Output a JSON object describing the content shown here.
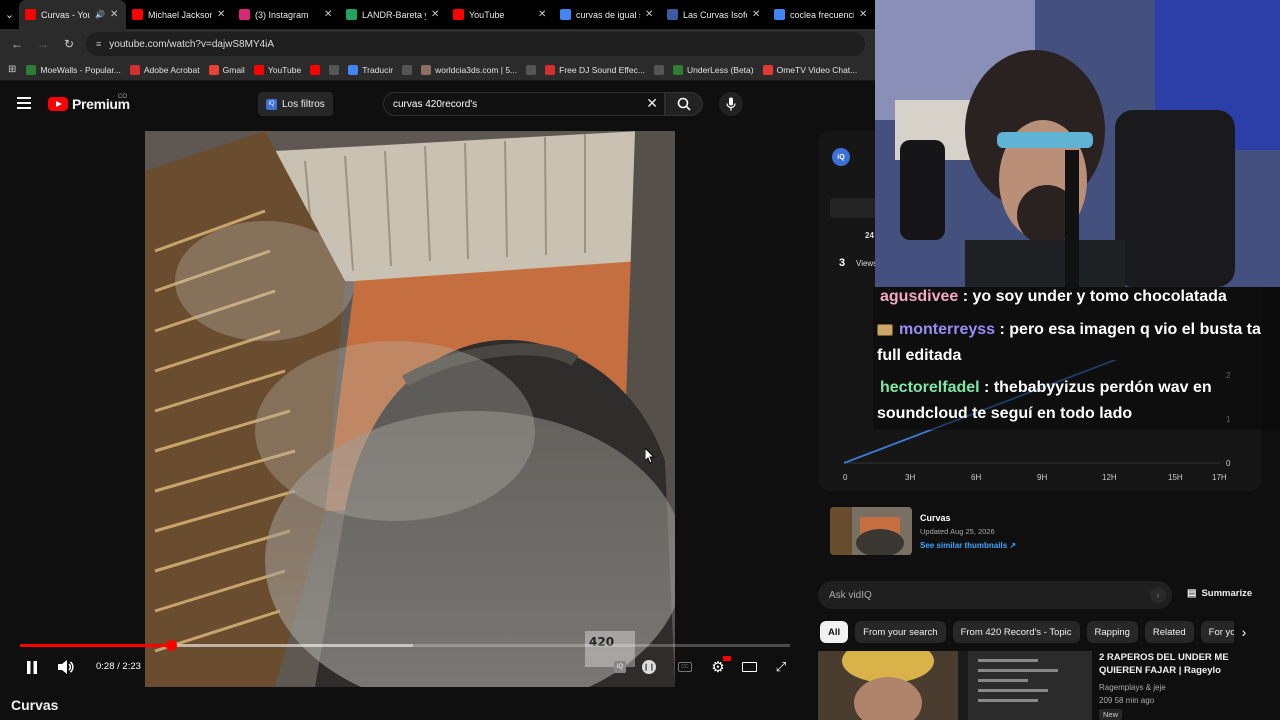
{
  "browser": {
    "tabs": [
      {
        "title": "Curvas - YouTu",
        "icon": "youtube-icon",
        "color": "#ff0000",
        "active": true,
        "audio": true
      },
      {
        "title": "Michael Jackson",
        "icon": "youtube-icon",
        "color": "#ff0000"
      },
      {
        "title": "(3) Instagram",
        "icon": "instagram-icon",
        "color": "#d62976"
      },
      {
        "title": "LANDR-Bareta y",
        "icon": "drive-icon",
        "color": "#1fa463"
      },
      {
        "title": "YouTube",
        "icon": "youtube-icon",
        "color": "#ff0000"
      },
      {
        "title": "curvas de igual s",
        "icon": "google-icon",
        "color": "#4285f4"
      },
      {
        "title": "Las Curvas Isofón",
        "icon": "site-icon",
        "color": "#3b5ba5"
      },
      {
        "title": "coclea frecuencia",
        "icon": "google-icon",
        "color": "#4285f4"
      }
    ],
    "url": "youtube.com/watch?v=dajwS8MY4iA",
    "bookmarks": [
      {
        "label": "MoeWalls - Popular...",
        "icon": "moewalls-icon",
        "color": "#2e7d32"
      },
      {
        "label": "Adobe Acrobat",
        "icon": "acrobat-icon",
        "color": "#d32f2f"
      },
      {
        "label": "Gmail",
        "icon": "gmail-icon",
        "color": "#ea4335"
      },
      {
        "label": "YouTube",
        "icon": "youtube-icon",
        "color": "#ff0000"
      },
      {
        "label": "",
        "icon": "youtube-icon",
        "color": "#ff0000"
      },
      {
        "label": "",
        "icon": "globe-icon",
        "color": "#555555"
      },
      {
        "label": "Traducir",
        "icon": "translate-icon",
        "color": "#4285f4"
      },
      {
        "label": "",
        "icon": "globe-icon",
        "color": "#555555"
      },
      {
        "label": "worldcia3ds.com | 5...",
        "icon": "worldcia-icon",
        "color": "#8d6e63"
      },
      {
        "label": "",
        "icon": "globe-icon",
        "color": "#555555"
      },
      {
        "label": "Free DJ Sound Effec...",
        "icon": "dj-icon",
        "color": "#d32f2f"
      },
      {
        "label": "",
        "icon": "globe-icon",
        "color": "#555555"
      },
      {
        "label": "UnderLess (Beta)",
        "icon": "underless-icon",
        "color": "#2e7d32"
      },
      {
        "label": "OmeTV Video Chat...",
        "icon": "ometv-icon",
        "color": "#e53935"
      }
    ]
  },
  "youtube": {
    "logo_text": "Premium",
    "country": "CO",
    "filters_label": "Los filtros",
    "search_value": "curvas 420record's",
    "video_title": "Curvas",
    "time_current": "0:28",
    "time_sep": "/",
    "time_total": "2:23",
    "played_fraction": 0.196,
    "buffered_fraction": 0.51
  },
  "vidiq": {
    "number_24": "24",
    "views_count": "3",
    "views_label": "Views",
    "chart_x_ticks": [
      "0",
      "3H",
      "6H",
      "9H",
      "12H",
      "15H",
      "17H"
    ],
    "chart_y_ticks": [
      "0",
      "1",
      "2"
    ],
    "thumb_title": "Curvas",
    "thumb_updated": "Updated Aug 25, 2026",
    "thumb_link": "See similar thumbnails ↗",
    "ask_placeholder": "Ask vidIQ",
    "summarize_label": "Summarize"
  },
  "chips": [
    "All",
    "From your search",
    "From 420 Record's - Topic",
    "Rapping",
    "Related",
    "For you"
  ],
  "recommended": {
    "title": "2 RAPEROS DEL UNDER ME QUIEREN FAJAR | Rageylo",
    "channel": "Ragemplays & jeje",
    "meta": "209  58 min ago",
    "badge": "New"
  },
  "chat": [
    {
      "user": "agusdivee",
      "color": "#f4a7c3",
      "text": ": yo soy under y tomo chocolatada",
      "emote": false
    },
    {
      "user": "monterreyss",
      "color": "#9b8cf5",
      "text": ": pero esa imagen q vio el busta ta full editada",
      "emote": true
    },
    {
      "user": "hectorelfadel",
      "color": "#7de8a6",
      "text": ": thebabyyizus perdón wav en soundcloud te seguí en todo lado",
      "emote": false
    }
  ]
}
